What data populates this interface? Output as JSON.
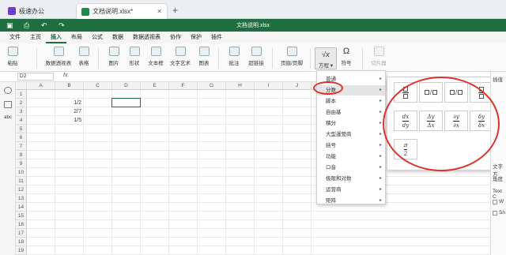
{
  "tabs": [
    {
      "label": "极速办公",
      "close": ""
    },
    {
      "label": "文档说明.xlsx*",
      "close": "✕"
    }
  ],
  "new_tab": "+",
  "doc_title": "文档说明.xlsx",
  "menu": [
    "文件",
    "主页",
    "插入",
    "布局",
    "公式",
    "数据",
    "数据透视表",
    "协作",
    "保护",
    "插件"
  ],
  "ribbon": {
    "paste": "粘贴",
    "pivot": "数据透视表",
    "table": "表格",
    "image": "图片",
    "shape": "形状",
    "textbox": "文本框",
    "textart": "文字艺术",
    "chart": "图表",
    "comment": "批注",
    "hyperlink": "超链接",
    "header_footer": "页眉/页脚",
    "formula": "方程",
    "formula_icon": "√x",
    "symbol": "符号",
    "symbol_icon": "Ω",
    "slicer": "切片器"
  },
  "name_box": "D2",
  "fx": "fx",
  "columns": [
    "A",
    "B",
    "C",
    "D",
    "E",
    "F",
    "G",
    "H",
    "I",
    "J"
  ],
  "rows": [
    "1",
    "2",
    "3",
    "4",
    "5",
    "6",
    "7",
    "8",
    "9",
    "10",
    "11",
    "12",
    "13",
    "14",
    "15",
    "16",
    "17",
    "18",
    "19"
  ],
  "cells": [
    {
      "row": "2",
      "col": "B",
      "value": "1/2"
    },
    {
      "row": "3",
      "col": "B",
      "value": "2/7"
    },
    {
      "row": "4",
      "col": "B",
      "value": "1/5"
    }
  ],
  "dropdown": {
    "items": [
      "普通",
      "分数",
      "脚本",
      "自由基",
      "積分",
      "大型運營商",
      "括号",
      "功能",
      "口音",
      "极限和对数",
      "运营商",
      "矩阵"
    ],
    "hovered": "分数"
  },
  "fraction_submenu": {
    "row2": [
      {
        "num": "dx",
        "den": "dy"
      },
      {
        "num": "Δy",
        "den": "Δx"
      },
      {
        "num": "∂y",
        "den": "∂x"
      },
      {
        "num": "δy",
        "den": "δx"
      }
    ],
    "row3": [
      {
        "num": "π",
        "den": "2"
      }
    ]
  },
  "right_panel": {
    "heading": "插值",
    "items": [
      "文字方",
      "角度",
      "Text C",
      "W",
      "Sh"
    ]
  },
  "colors": {
    "brand_green": "#1e6e3f",
    "annotation_red": "#d9332b"
  }
}
